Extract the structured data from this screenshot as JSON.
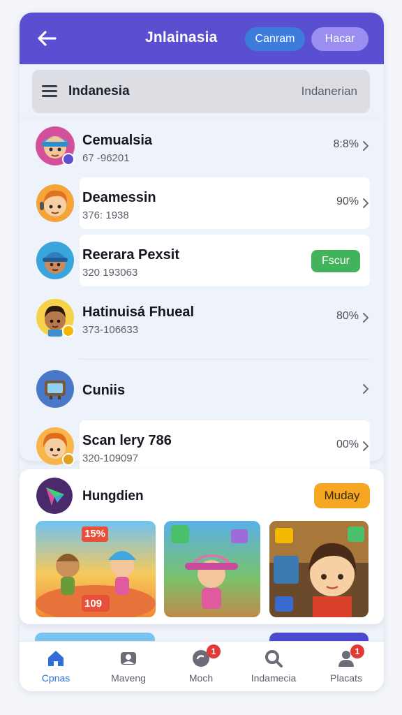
{
  "header": {
    "title": "Jnlainasia",
    "primary_button": "Canram",
    "secondary_button": "Hacar",
    "back_icon": "arrow-left-icon"
  },
  "searchbar": {
    "title": "Indanesia",
    "right_text": "Indanerian",
    "menu_icon": "hamburger-menu-icon"
  },
  "list": [
    {
      "name": "Cemualsia",
      "subtitle": "67 -96201",
      "value": "8:8%",
      "avatar_color": "#6fb8e8"
    },
    {
      "name": "Deamessin",
      "subtitle": "376:  1938",
      "value": "90%",
      "avatar_color": "#f29a3a"
    },
    {
      "name": "Reerara Pexsit",
      "subtitle": "320 193063",
      "action": "Fscur",
      "avatar_color": "#3aa4dc"
    },
    {
      "name": "Hatinuisá Fhueal",
      "subtitle": "373-106633",
      "value": "80%",
      "avatar_color": "#f5d24a"
    },
    {
      "name": "Cuniis",
      "subtitle": "",
      "value": "",
      "avatar_color": "#4a78c8"
    },
    {
      "name": "Scan lery 786",
      "subtitle": "320-109097",
      "value": "00%",
      "avatar_color": "#f5a030"
    }
  ],
  "featured": {
    "title": "Hungdien",
    "button": "Muday",
    "thumbnails": [
      {
        "badge_top": "15%",
        "badge_bottom": "109"
      },
      {
        "badge_top": "",
        "badge_bottom": ""
      },
      {
        "badge_top": "",
        "badge_bottom": ""
      }
    ]
  },
  "tabs": [
    {
      "label": "Cpnas",
      "icon": "home-icon",
      "active": true,
      "badge": ""
    },
    {
      "label": "Maveng",
      "icon": "gallery-icon",
      "active": false,
      "badge": ""
    },
    {
      "label": "Moch",
      "icon": "chat-icon",
      "active": false,
      "badge": "1"
    },
    {
      "label": "Indamecia",
      "icon": "search-icon",
      "active": false,
      "badge": ""
    },
    {
      "label": "Placats",
      "icon": "profile-icon",
      "active": false,
      "badge": "1"
    }
  ],
  "colors": {
    "header_bg": "#5a4fd0",
    "primary_button": "#3d7bdc",
    "secondary_button": "#9a8ef0",
    "accent_green": "#43b35b",
    "accent_orange": "#f5a623",
    "active_tab": "#2f6fd8",
    "notification": "#e53935"
  }
}
